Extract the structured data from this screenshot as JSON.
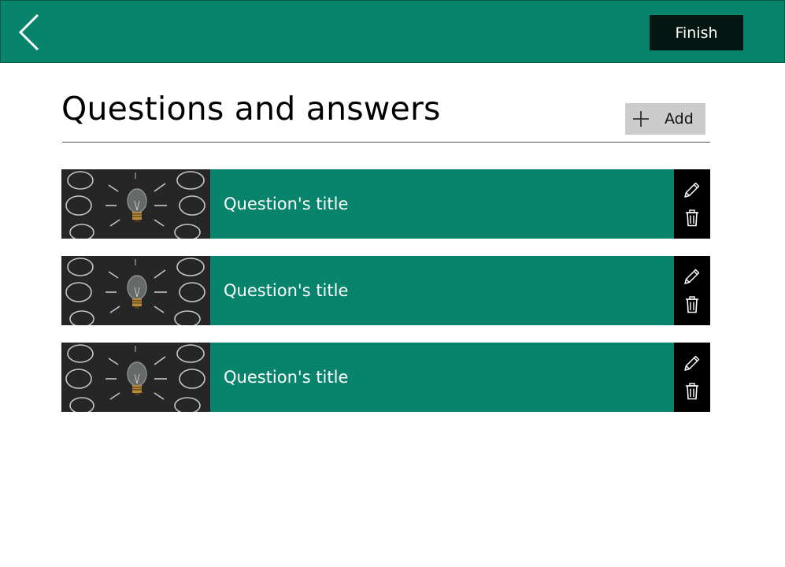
{
  "colors": {
    "accent": "#07846b",
    "finishBg": "#041712",
    "addBg": "#cccccc"
  },
  "header": {
    "back_icon": "chevron-left-icon",
    "finish_label": "Finish"
  },
  "main": {
    "title": "Questions and answers",
    "add_label": "Add",
    "add_icon": "plus-icon"
  },
  "questions": [
    {
      "title": "Question's title",
      "image": "lightbulb-image"
    },
    {
      "title": "Question's title",
      "image": "lightbulb-image"
    },
    {
      "title": "Question's title",
      "image": "lightbulb-image"
    }
  ],
  "row_actions": {
    "edit_icon": "pencil-icon",
    "delete_icon": "trash-icon"
  }
}
